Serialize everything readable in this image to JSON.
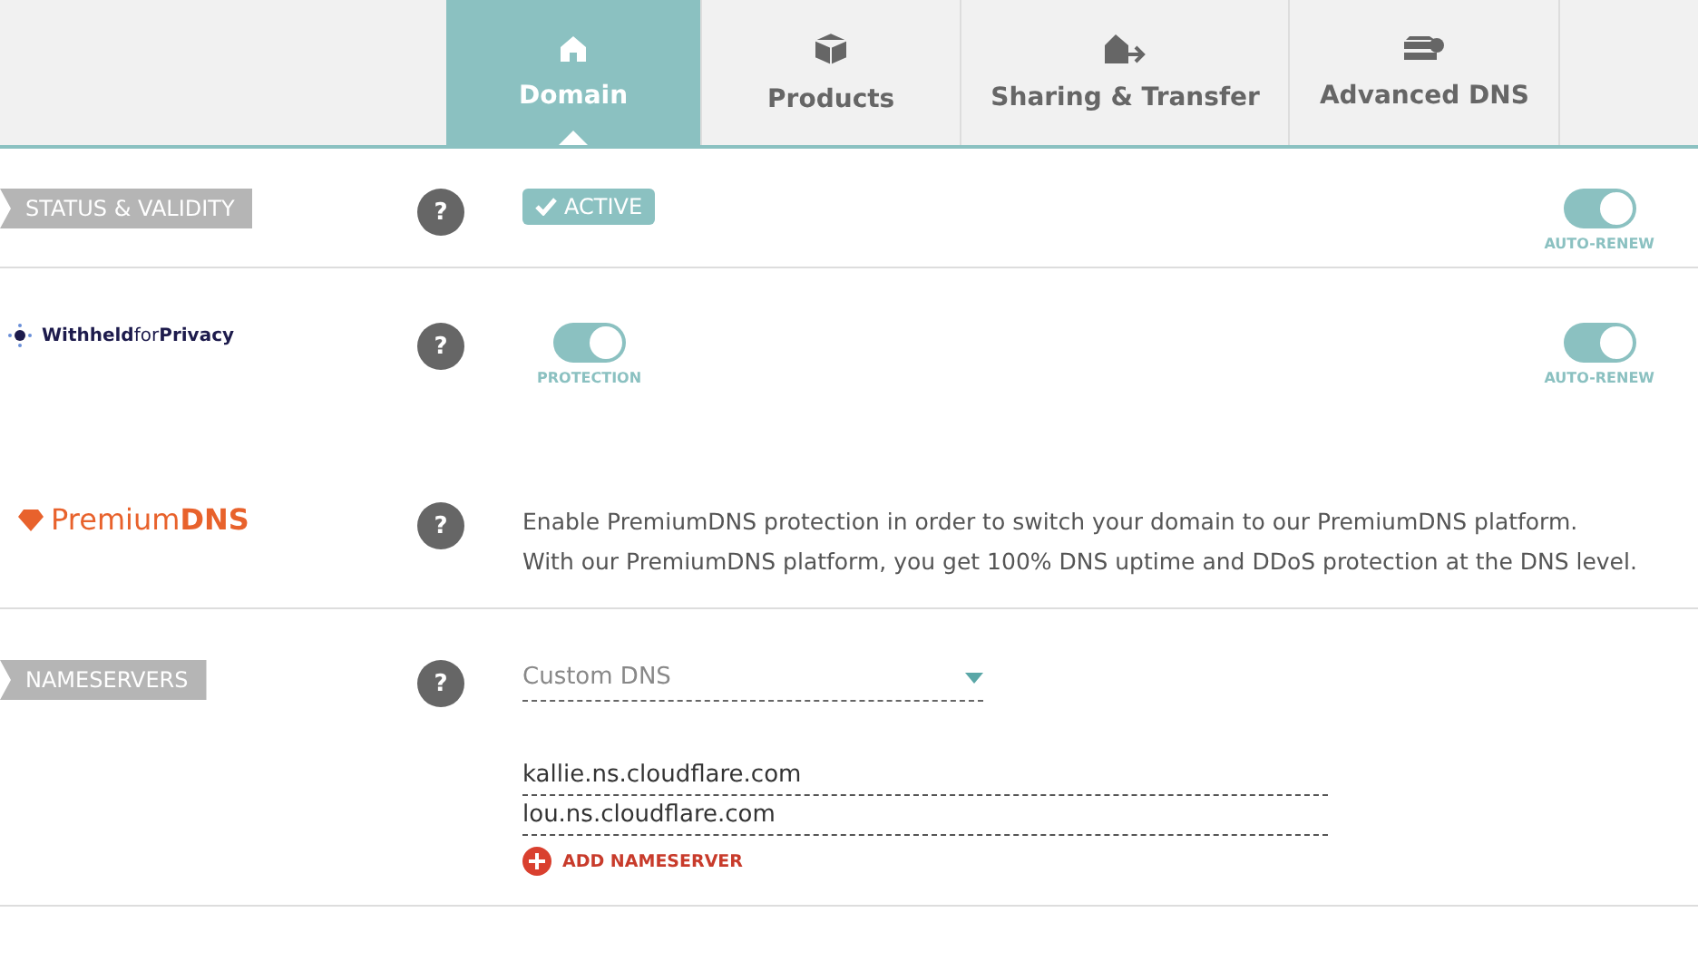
{
  "tabs": [
    {
      "label": "Domain",
      "selected": true
    },
    {
      "label": "Products",
      "selected": false
    },
    {
      "label": "Sharing & Transfer",
      "selected": false
    },
    {
      "label": "Advanced DNS",
      "selected": false
    }
  ],
  "rows": [
    {
      "kind": "status",
      "help": "?",
      "label": "STATUS & VALIDITY",
      "status": "ACTIVE",
      "auto_renew": {
        "label": "AUTO-RENEW",
        "on": true
      }
    },
    {
      "kind": "privacy",
      "help": "?",
      "logo": "**Withheld**for**Privacy**",
      "protection": {
        "label": "PROTECTION",
        "on": true
      },
      "auto_renew": {
        "label": "AUTO-RENEW",
        "on": true
      }
    },
    {
      "kind": "premium",
      "help": "?",
      "logo": "Premium**DNS**",
      "lines": [
        "Enable PremiumDNS protection in order to switch your domain to our PremiumDNS platform.",
        "With our PremiumDNS platform, you get 100% DNS uptime and DDoS protection at the DNS level."
      ]
    },
    {
      "kind": "nameservers",
      "help": "?",
      "label": "NAMESERVERS",
      "dns_type": "Custom DNS",
      "nameservers": [
        "kallie.ns.cloudflare.com",
        "lou.ns.cloudflare.com"
      ],
      "add_label": "ADD NAMESERVER"
    }
  ]
}
